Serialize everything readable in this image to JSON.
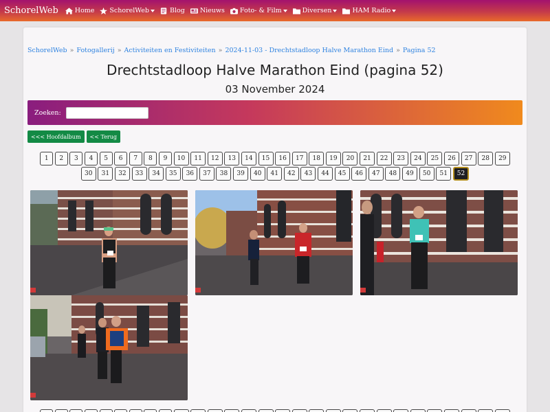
{
  "nav": {
    "brand": "SchorelWeb",
    "items": [
      {
        "label": "Home",
        "icon": "home-icon",
        "dropdown": false
      },
      {
        "label": "SchorelWeb",
        "icon": "star-icon",
        "dropdown": true
      },
      {
        "label": "Blog",
        "icon": "blog-icon",
        "dropdown": false
      },
      {
        "label": "Nieuws",
        "icon": "newspaper-icon",
        "dropdown": false
      },
      {
        "label": "Foto- & Film",
        "icon": "camera-icon",
        "dropdown": true
      },
      {
        "label": "Diversen",
        "icon": "folder-icon",
        "dropdown": true
      },
      {
        "label": "HAM Radio",
        "icon": "folder-icon",
        "dropdown": true
      }
    ]
  },
  "breadcrumb": [
    "SchorelWeb",
    "Fotogallerij",
    "Activiteiten en Festiviteiten",
    "2024-11-03 - Drechtstadloop Halve Marathon Eind",
    "Pagina 52"
  ],
  "breadcrumb_separator": "»",
  "page": {
    "title": "Drechtstadloop Halve Marathon Eind (pagina 52)",
    "date": "03 November 2024"
  },
  "search": {
    "label": "Zoeken:",
    "value": "",
    "placeholder": ""
  },
  "buttons": {
    "main_album": "<<< Hoofdalbum",
    "back": "<< Terug"
  },
  "pagination": {
    "row1": [
      "1",
      "2",
      "3",
      "4",
      "5",
      "6",
      "7",
      "8",
      "9",
      "10",
      "11",
      "12",
      "13",
      "14",
      "15",
      "16",
      "17",
      "18",
      "19",
      "20",
      "21",
      "22",
      "23",
      "24",
      "25",
      "26",
      "27",
      "28",
      "29"
    ],
    "row2": [
      "30",
      "31",
      "32",
      "33",
      "34",
      "35",
      "36",
      "37",
      "38",
      "39",
      "40",
      "41",
      "42",
      "43",
      "44",
      "45",
      "46",
      "47",
      "48",
      "49",
      "50",
      "51",
      "52"
    ],
    "current": "52"
  },
  "photos": [
    {
      "name": "photo-runner-woman-green-cap",
      "marker": "S"
    },
    {
      "name": "photo-runners-red-shirt",
      "marker": "S"
    },
    {
      "name": "photo-runner-teal-shirt",
      "marker": "S"
    },
    {
      "name": "photo-runners-orange-jacket",
      "marker": "S"
    }
  ],
  "colors": {
    "navbar": "#b22a5c",
    "accent_link": "#2f83e0",
    "button_green": "#138a45",
    "active_page": "#1e1e22"
  }
}
